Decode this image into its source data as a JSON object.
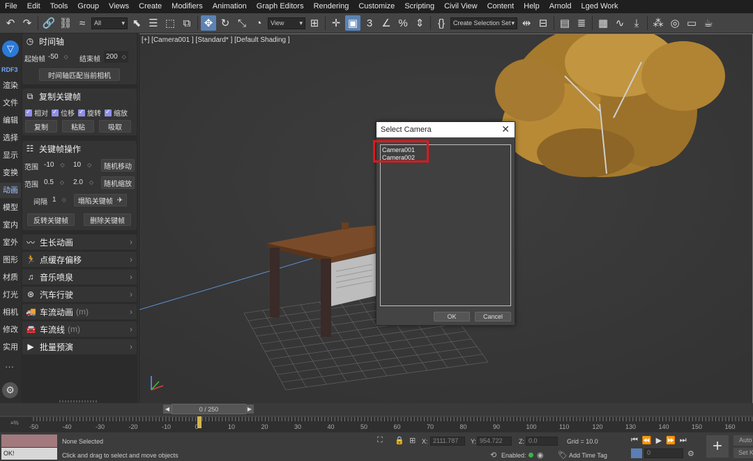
{
  "menu": [
    "File",
    "Edit",
    "Tools",
    "Group",
    "Views",
    "Create",
    "Modifiers",
    "Animation",
    "Graph Editors",
    "Rendering",
    "Customize",
    "Scripting",
    "Civil View",
    "Content",
    "Help",
    "Arnold",
    "Lged Work"
  ],
  "toolbar": {
    "filter_value": "All",
    "view_value": "View",
    "selection_set": "Create Selection Set",
    "icons": [
      "undo-icon",
      "redo-icon",
      "link-icon",
      "unlink-icon",
      "bind-spacewarp-icon",
      "select-object-icon",
      "select-by-name-icon",
      "rect-region-icon",
      "window-crossing-icon",
      "move-icon",
      "rotate-icon",
      "scale-icon",
      "place-icon",
      "pivot-icon",
      "snap-icon",
      "angle-snap-icon",
      "percent-snap-icon",
      "spinner-snap-icon",
      "edit-named-sets-icon",
      "mirror-icon",
      "align-icon",
      "scene-explorer-icon",
      "layer-explorer-icon",
      "ribbon-icon",
      "curve-editor-icon",
      "schematic-icon",
      "material-editor-icon",
      "render-setup-icon",
      "render-icon"
    ]
  },
  "leftstrip": {
    "brand": "RDF3",
    "categories": [
      "渲染",
      "文件",
      "编辑",
      "选择",
      "显示",
      "变换",
      "动画",
      "模型",
      "室内",
      "室外",
      "图形",
      "材质",
      "灯光",
      "相机",
      "修改",
      "实用"
    ],
    "selected": "动画",
    "more": "···"
  },
  "panel": {
    "timeline": {
      "title": "时间轴",
      "start_label": "起始帧",
      "start_value": "-50",
      "end_label": "结束帧",
      "end_value": "200",
      "match_button": "时间轴匹配当前相机"
    },
    "copy_keys": {
      "title": "复制关键帧",
      "checks": [
        "相对",
        "位移",
        "旋转",
        "缩放"
      ],
      "buttons": [
        "复制",
        "粘贴",
        "吸取"
      ]
    },
    "key_ops": {
      "title": "关键帧操作",
      "range_label": "范围",
      "range1_from": "-10",
      "range1_to": "10",
      "random_move": "随机移动",
      "range2_from": "0.5",
      "range2_to": "2.0",
      "random_scale": "随机缩放",
      "interval_label": "间隔",
      "interval_value": "1",
      "collapse_button": "塌陷关键帧",
      "reverse_button": "反转关键帧",
      "delete_button": "删除关键帧"
    },
    "items": [
      {
        "label": "生长动画",
        "suffix": "",
        "icon": "wave-icon"
      },
      {
        "label": "点缓存偏移",
        "suffix": "",
        "icon": "runner-icon"
      },
      {
        "label": "音乐喷泉",
        "suffix": "",
        "icon": "music-icon"
      },
      {
        "label": "汽车行驶",
        "suffix": "",
        "icon": "steering-wheel-icon"
      },
      {
        "label": "车流动画",
        "suffix": "(m)",
        "icon": "truck-icon"
      },
      {
        "label": "车流线",
        "suffix": "(m)",
        "icon": "car-icon"
      },
      {
        "label": "批量预演",
        "suffix": "",
        "icon": "play-icon"
      }
    ]
  },
  "viewport": {
    "label": "[+] [Camera001 ] [Standard* ] [Default Shading ]"
  },
  "dialog": {
    "title": "Select Camera",
    "cameras": [
      "Camera001",
      "Camera002"
    ],
    "ok": "OK",
    "cancel": "Cancel"
  },
  "timeslider": {
    "position": "0 / 250"
  },
  "track": {
    "ticks": [
      "-50",
      "-40",
      "-30",
      "-20",
      "-10",
      "0",
      "10",
      "20",
      "30",
      "40",
      "50",
      "60",
      "70",
      "80",
      "90",
      "100",
      "110",
      "120",
      "130",
      "140",
      "150",
      "160"
    ]
  },
  "status": {
    "selection": "None Selected",
    "prompt": "Click and drag to select and move objects",
    "maxscript": "OK!",
    "x_label": "X:",
    "x_value": "2111.787",
    "y_label": "Y:",
    "y_value": "954.722",
    "z_label": "Z:",
    "z_value": "0.0",
    "grid": "Grid = 10.0",
    "enabled": "Enabled:",
    "add_time_tag": "Add Time Tag",
    "frame_value": "0",
    "auto": "Auto",
    "setk": "Set K"
  }
}
